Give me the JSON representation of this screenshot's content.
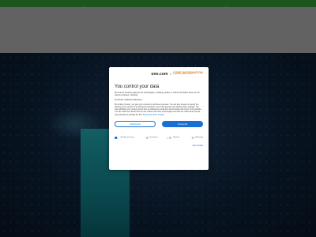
{
  "modal": {
    "logo_brand": "one.com",
    "logo_separator": "×",
    "logo_partner_name": "CORE INFORMATION",
    "logo_partner_sub": "consent management platform",
    "title": "You control your data",
    "intro": "We and our business partners use technologies, including cookies, to collect information about you for various purposes, including:",
    "purposes": "Functional, Statistical, Marketing",
    "body": "By clicking 'Accept', you give your consent for all these purposes. You can also choose to specify the purposes you consent to by ticking the checkbox next to the purpose and clicking 'Save settings'. You may withdraw your consent at any time by clicking the small icon at the bottom left corner of the website. You can read more about how we use cookies and other technologies and how we collect and process personal data by clicking the link.",
    "more_link": "Read more about cookies",
    "decline_label": "Decline all",
    "accept_label": "Accept all",
    "toggles": [
      {
        "label": "Strictly necessary",
        "on": true
      },
      {
        "label": "Functional",
        "on": false
      },
      {
        "label": "Statistics",
        "on": false
      },
      {
        "label": "Marketing",
        "on": false
      }
    ],
    "details_link": "Show details"
  },
  "colors": {
    "accent": "#1a6fd4",
    "topbar": "#2e8b2e",
    "brand_orange": "#e07b1a"
  }
}
